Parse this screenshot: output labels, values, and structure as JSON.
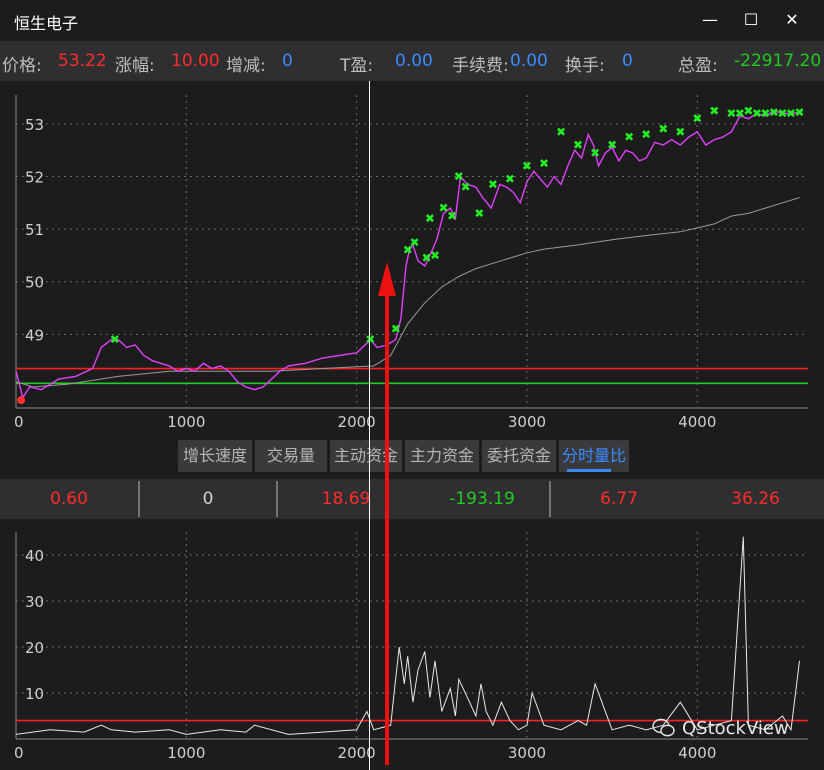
{
  "window": {
    "title": "恒生电子",
    "minimize_glyph": "—",
    "maximize_glyph": "☐",
    "close_glyph": "✕"
  },
  "infobar": {
    "price_label": "价格:",
    "price_value": "53.22",
    "change_label": "涨幅:",
    "change_value": "10.00",
    "delta_label": "增减:",
    "delta_value": "0",
    "t_label": "T盈:",
    "t_value": "0.00",
    "fee_label": "手续费:",
    "fee_value": "0.00",
    "turnover_label": "换手:",
    "turnover_value": "0",
    "total_label": "总盈:",
    "total_value": "-22917.20"
  },
  "tabs": {
    "items": [
      "增长速度",
      "交易量",
      "主动资金",
      "主力资金",
      "委托资金",
      "分时量比"
    ],
    "active": "分时量比"
  },
  "stats": {
    "values": [
      "0.60",
      "0",
      "18.69",
      "-193.19",
      "6.77",
      "36.26"
    ]
  },
  "watermark": "QStockView",
  "chart_data": [
    {
      "type": "line",
      "x_ticks": [
        "0",
        "1000",
        "2000",
        "3000",
        "4000"
      ],
      "y_ticks": [
        "49",
        "50",
        "51",
        "52",
        "53"
      ],
      "xlim": [
        0,
        4650
      ],
      "ylim": [
        47.6,
        53.55
      ],
      "grid": "dotted",
      "reference_lines": [
        {
          "value": 48.35,
          "color": "#ff2020"
        },
        {
          "value": 48.07,
          "color": "#22cc22"
        }
      ],
      "price_series": {
        "color": "#e040fb",
        "x": [
          0,
          40,
          80,
          150,
          250,
          350,
          450,
          500,
          560,
          600,
          650,
          700,
          750,
          800,
          850,
          900,
          950,
          1000,
          1050,
          1100,
          1150,
          1200,
          1250,
          1300,
          1350,
          1400,
          1450,
          1500,
          1550,
          1600,
          1700,
          1800,
          1900,
          2000,
          2050,
          2080,
          2120,
          2180,
          2230,
          2260,
          2290,
          2310,
          2330,
          2360,
          2400,
          2430,
          2470,
          2510,
          2550,
          2580,
          2610,
          2650,
          2700,
          2740,
          2790,
          2840,
          2880,
          2920,
          2960,
          3000,
          3040,
          3080,
          3120,
          3160,
          3200,
          3240,
          3280,
          3320,
          3360,
          3390,
          3420,
          3460,
          3500,
          3540,
          3580,
          3620,
          3660,
          3700,
          3750,
          3800,
          3850,
          3900,
          3950,
          4000,
          4050,
          4100,
          4150,
          4200,
          4250,
          4300,
          4350,
          4400,
          4450,
          4500,
          4550,
          4600
        ],
        "y": [
          48.3,
          47.8,
          48.0,
          47.95,
          48.15,
          48.2,
          48.35,
          48.75,
          48.9,
          48.9,
          48.75,
          48.8,
          48.6,
          48.5,
          48.45,
          48.4,
          48.3,
          48.35,
          48.3,
          48.45,
          48.35,
          48.4,
          48.3,
          48.1,
          48.0,
          47.95,
          48.0,
          48.15,
          48.3,
          48.4,
          48.45,
          48.55,
          48.6,
          48.65,
          48.8,
          48.9,
          48.75,
          48.8,
          48.9,
          49.3,
          50.3,
          50.6,
          50.7,
          50.4,
          50.3,
          50.5,
          50.8,
          51.3,
          51.4,
          51.2,
          52.0,
          51.85,
          51.8,
          51.6,
          51.4,
          51.85,
          51.8,
          51.7,
          51.5,
          51.9,
          52.1,
          51.95,
          51.8,
          52.0,
          51.85,
          52.2,
          52.5,
          52.35,
          52.8,
          52.6,
          52.2,
          52.45,
          52.55,
          52.3,
          52.5,
          52.45,
          52.3,
          52.35,
          52.65,
          52.6,
          52.7,
          52.6,
          52.75,
          52.85,
          52.6,
          52.7,
          52.75,
          52.85,
          53.15,
          53.1,
          53.2,
          53.15,
          53.25,
          53.2,
          53.2,
          53.22
        ]
      },
      "avg_series": {
        "color": "#9a9a9a",
        "x": [
          0,
          100,
          300,
          600,
          900,
          1200,
          1500,
          1800,
          2100,
          2200,
          2300,
          2400,
          2500,
          2600,
          2700,
          2800,
          2900,
          3000,
          3100,
          3300,
          3500,
          3700,
          3900,
          4100,
          4200,
          4300,
          4400,
          4500,
          4600
        ],
        "y": [
          48.1,
          48.0,
          48.05,
          48.2,
          48.3,
          48.3,
          48.3,
          48.35,
          48.4,
          48.6,
          49.2,
          49.6,
          49.9,
          50.1,
          50.25,
          50.35,
          50.45,
          50.55,
          50.62,
          50.7,
          50.8,
          50.88,
          50.95,
          51.1,
          51.25,
          51.3,
          51.4,
          51.5,
          51.6
        ]
      },
      "green_markers": {
        "color": "#22ee22",
        "x": [
          580,
          2080,
          2230,
          2300,
          2340,
          2410,
          2430,
          2460,
          2510,
          2560,
          2600,
          2640,
          2720,
          2800,
          2900,
          3000,
          3100,
          3200,
          3300,
          3400,
          3500,
          3600,
          3700,
          3800,
          3900,
          4000,
          4100,
          4200,
          4250,
          4300,
          4350,
          4400,
          4450,
          4500,
          4550,
          4600
        ],
        "y": [
          48.9,
          48.9,
          49.1,
          50.6,
          50.75,
          50.45,
          51.2,
          50.5,
          51.4,
          51.25,
          52.0,
          51.8,
          51.3,
          51.85,
          51.95,
          52.2,
          52.25,
          52.85,
          52.6,
          52.45,
          52.6,
          52.75,
          52.8,
          52.9,
          52.85,
          53.1,
          53.25,
          53.2,
          53.2,
          53.25,
          53.2,
          53.2,
          53.22,
          53.2,
          53.2,
          53.22
        ]
      },
      "red_markers": {
        "color": "#ff3030",
        "x": [
          30
        ],
        "y": [
          47.75
        ]
      }
    },
    {
      "type": "line",
      "x_ticks": [
        "0",
        "1000",
        "2000",
        "3000",
        "4000"
      ],
      "y_ticks": [
        "10",
        "20",
        "30",
        "40"
      ],
      "xlim": [
        0,
        4650
      ],
      "ylim": [
        0,
        45
      ],
      "grid": "dotted",
      "reference_lines": [
        {
          "value": 4.0,
          "color": "#ff2020"
        }
      ],
      "series": {
        "color": "#e8e8e8",
        "x": [
          0,
          200,
          400,
          500,
          560,
          700,
          900,
          1000,
          1200,
          1350,
          1400,
          1600,
          1800,
          2000,
          2060,
          2100,
          2200,
          2220,
          2250,
          2280,
          2300,
          2330,
          2360,
          2400,
          2430,
          2460,
          2500,
          2550,
          2580,
          2600,
          2650,
          2700,
          2730,
          2760,
          2800,
          2850,
          2900,
          2950,
          3000,
          3030,
          3100,
          3200,
          3300,
          3350,
          3400,
          3500,
          3600,
          3700,
          3800,
          3900,
          4000,
          4100,
          4200,
          4270,
          4300,
          4400,
          4500,
          4550,
          4600
        ],
        "y": [
          1,
          2,
          1.5,
          3,
          2,
          1.5,
          2,
          1,
          2,
          1.5,
          3,
          1,
          1.5,
          2,
          6,
          2,
          3,
          10,
          20,
          12,
          18,
          8,
          15,
          19,
          9,
          17,
          6,
          11,
          5,
          13,
          9,
          5,
          12,
          6,
          3,
          8,
          4,
          2,
          3,
          10,
          3,
          2,
          4,
          3,
          12,
          2,
          3,
          2,
          3,
          8,
          2,
          3,
          4,
          44,
          3,
          2,
          5,
          2,
          17
        ]
      }
    }
  ]
}
